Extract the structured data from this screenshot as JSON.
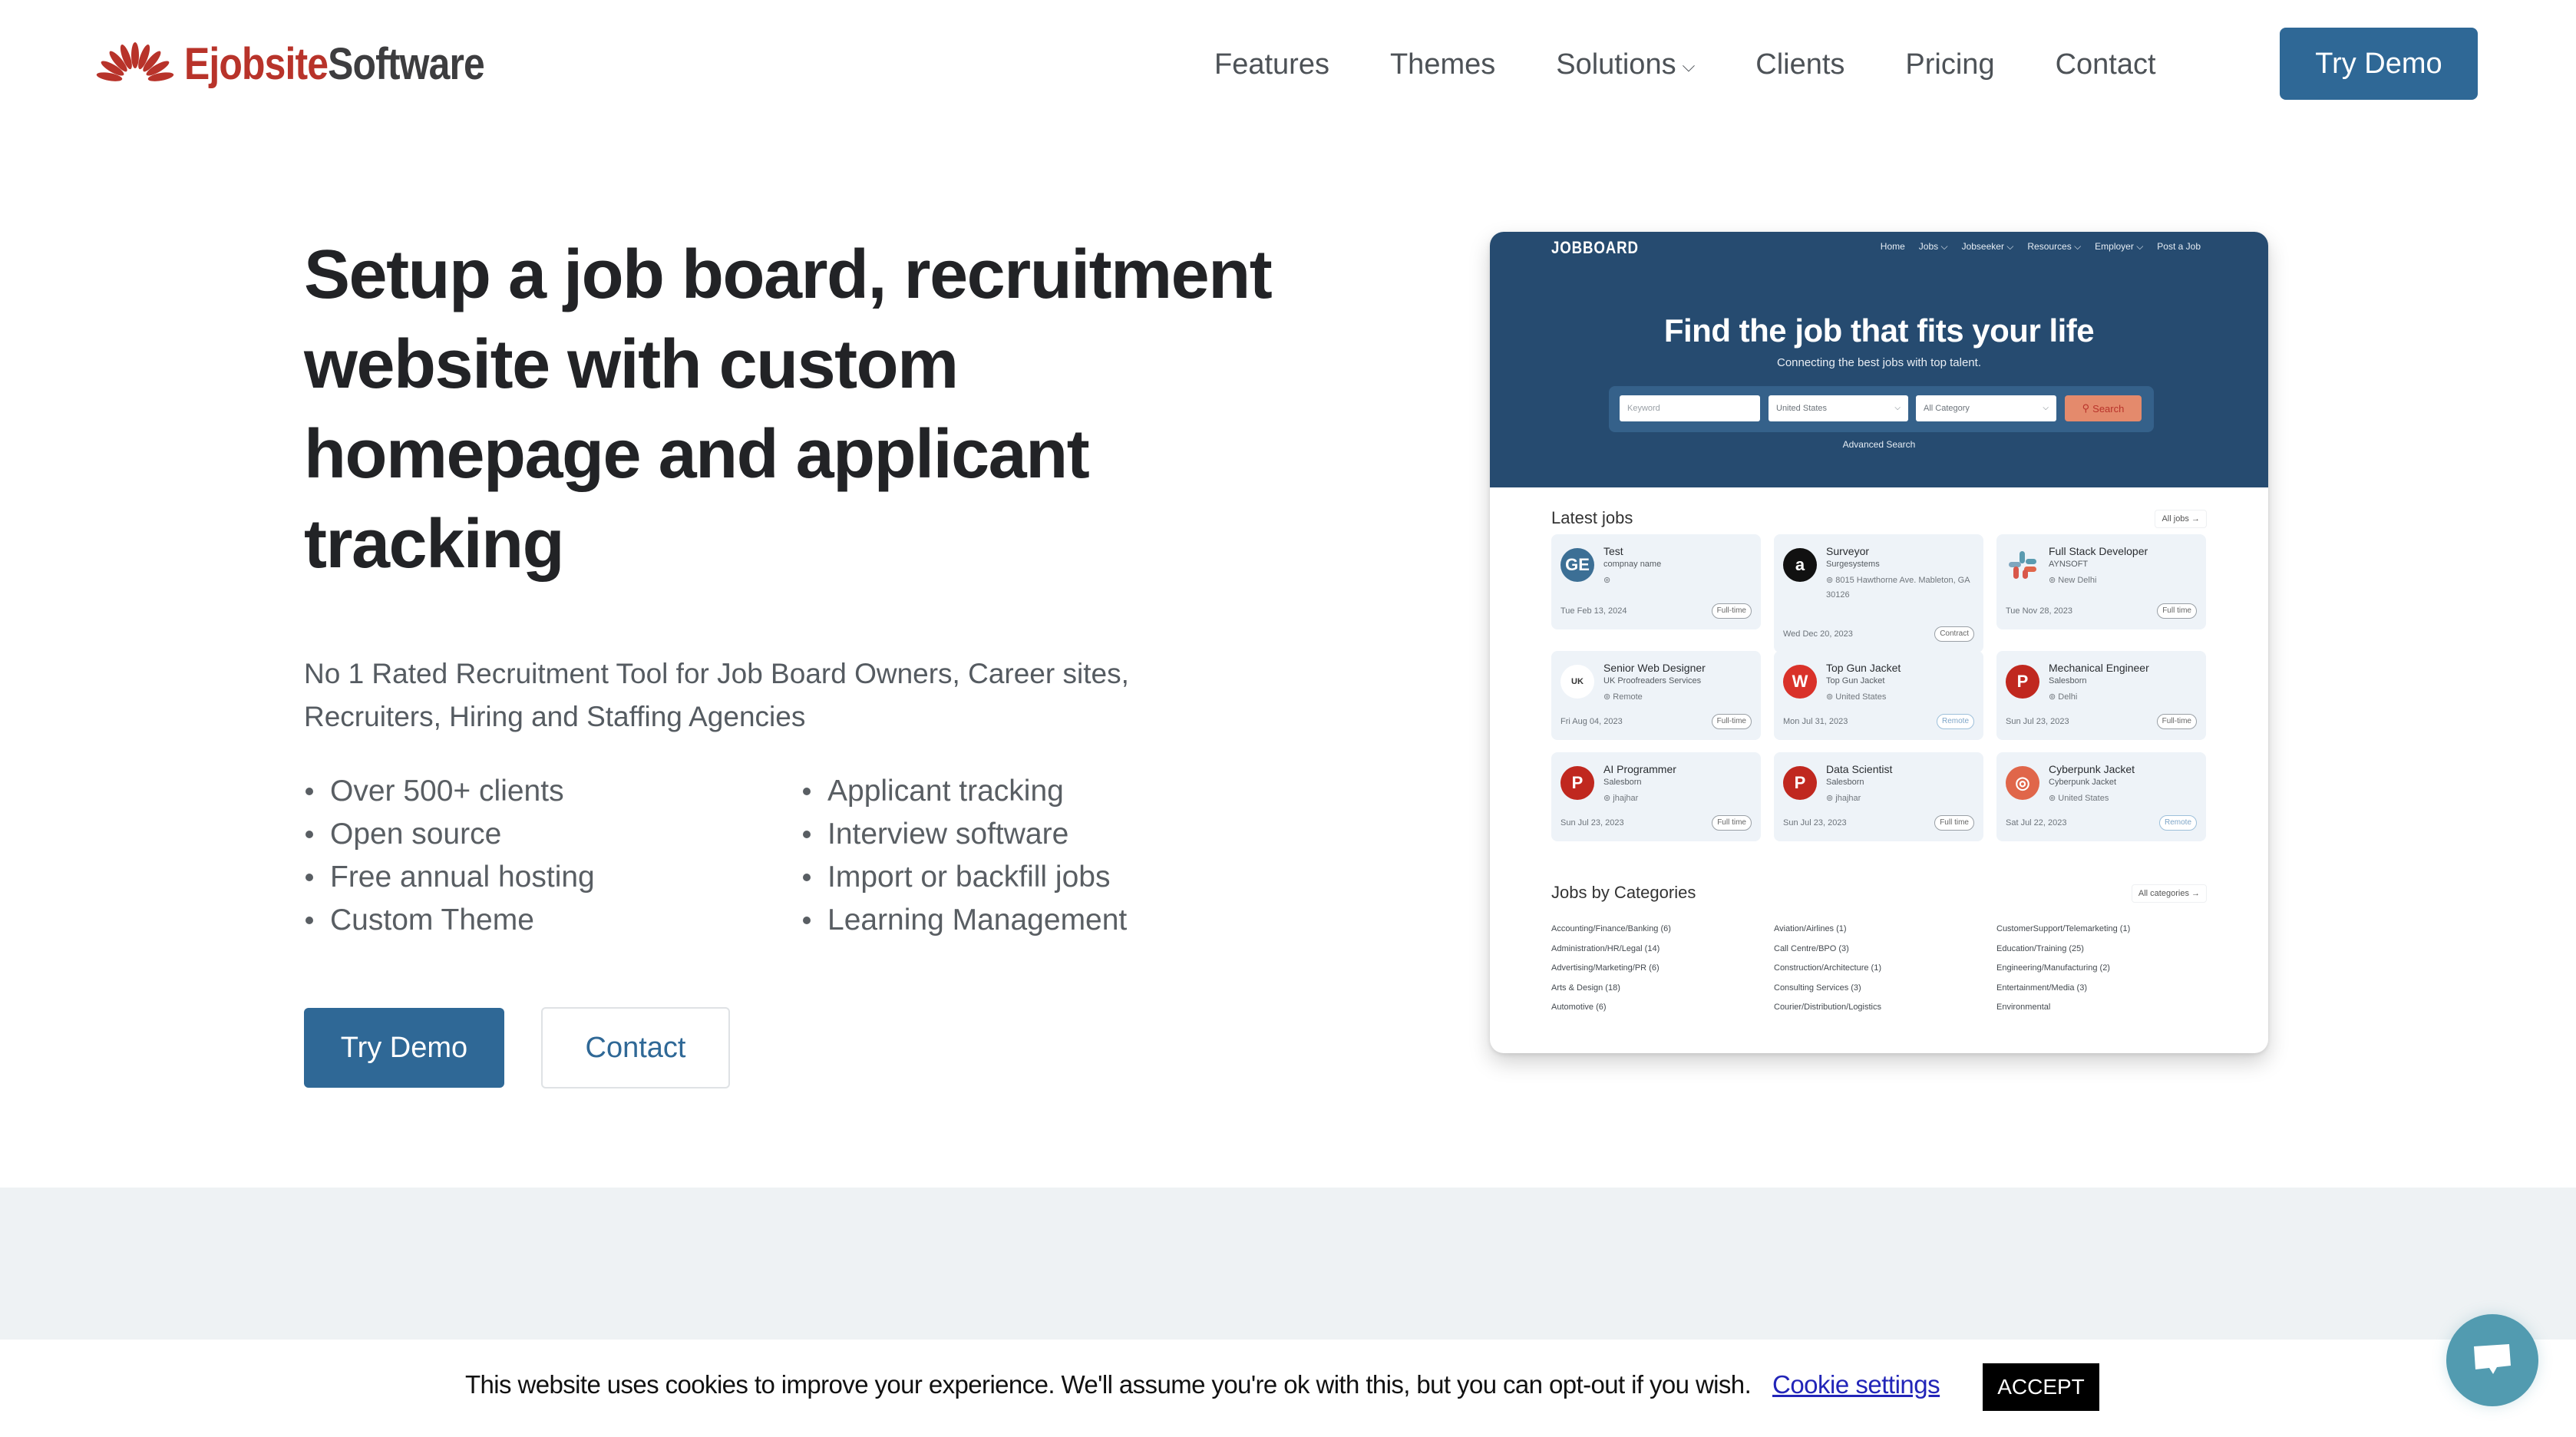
{
  "brand": {
    "name_part1": "Ejobsite",
    "name_part2": "Software",
    "colors": {
      "primary": "#2f6896",
      "logo_red": "#b8332a",
      "logo_gray": "#3d3d3f"
    }
  },
  "nav": {
    "items": [
      {
        "label": "Features",
        "has_dropdown": false
      },
      {
        "label": "Themes",
        "has_dropdown": false
      },
      {
        "label": "Solutions",
        "has_dropdown": true
      },
      {
        "label": "Clients",
        "has_dropdown": false
      },
      {
        "label": "Pricing",
        "has_dropdown": false
      },
      {
        "label": "Contact",
        "has_dropdown": false
      }
    ],
    "cta_label": "Try Demo"
  },
  "hero": {
    "headline": "Setup a job board, recruitment website with custom homepage and applicant tracking",
    "subtitle": "No 1 Rated Recruitment Tool for Job Board Owners, Career sites, Recruiters, Hiring and Staffing Agencies",
    "bullets_left": [
      "Over 500+ clients",
      "Open source",
      "Free annual hosting",
      "Custom Theme"
    ],
    "bullets_right": [
      "Applicant tracking",
      "Interview software",
      "Import or backfill jobs",
      "Learning Management"
    ],
    "primary_button": "Try Demo",
    "secondary_button": "Contact"
  },
  "mockup": {
    "brand": "JOBBOARD",
    "nav": [
      "Home",
      "Jobs ⌵",
      "Jobseeker ⌵",
      "Resources ⌵",
      "Employer ⌵",
      "Post a Job"
    ],
    "title": "Find the job that fits your life",
    "subtitle": "Connecting the best jobs with top talent.",
    "search": {
      "keyword_placeholder": "Keyword",
      "location_value": "United States",
      "category_value": "All Category",
      "button_label": "Search",
      "advanced_label": "Advanced Search"
    },
    "latest_jobs_title": "Latest jobs",
    "all_jobs_label": "All jobs →",
    "jobs": [
      {
        "title": "Test",
        "company": "compnay name",
        "location": "",
        "date": "Tue Feb 13, 2024",
        "type": "Full-time",
        "logo": "ge-logo",
        "logo_color": "#3c6f95",
        "logo_text": "GE"
      },
      {
        "title": "Surveyor",
        "company": "Surgesystems",
        "location": "8015 Hawthorne Ave. Mableton, GA 30126",
        "date": "Wed Dec 20, 2023",
        "type": "Contract",
        "logo": "amazon-logo",
        "logo_color": "#111111",
        "logo_text": "a"
      },
      {
        "title": "Full Stack Developer",
        "company": "AYNSOFT",
        "location": "New Delhi",
        "date": "Tue Nov 28, 2023",
        "type": "Full time",
        "logo": "slack-logo",
        "logo_color": "#eef3f8",
        "logo_text": ""
      },
      {
        "title": "Senior Web Designer",
        "company": "UK Proofreaders Services",
        "location": "Remote",
        "date": "Fri Aug 04, 2023",
        "type": "Full-time",
        "logo": "ukp-logo",
        "logo_color": "#ffffff",
        "logo_text": "UK"
      },
      {
        "title": "Top Gun Jacket",
        "company": "Top Gun Jacket",
        "location": "United States",
        "date": "Mon Jul 31, 2023",
        "type": "Remote",
        "logo": "walgreens-logo",
        "logo_color": "#d9322a",
        "logo_text": "W"
      },
      {
        "title": "Mechanical Engineer",
        "company": "Salesborn",
        "location": "Delhi",
        "date": "Sun Jul 23, 2023",
        "type": "Full-time",
        "logo": "pinterest-logo",
        "logo_color": "#c0281f",
        "logo_text": "P"
      },
      {
        "title": "AI Programmer",
        "company": "Salesborn",
        "location": "jhajhar",
        "date": "Sun Jul 23, 2023",
        "type": "Full time",
        "logo": "pinterest-logo",
        "logo_color": "#c0281f",
        "logo_text": "P"
      },
      {
        "title": "Data Scientist",
        "company": "Salesborn",
        "location": "jhajhar",
        "date": "Sun Jul 23, 2023",
        "type": "Full time",
        "logo": "pinterest-logo",
        "logo_color": "#c0281f",
        "logo_text": "P"
      },
      {
        "title": "Cyberpunk Jacket",
        "company": "Cyberpunk Jacket",
        "location": "United States",
        "date": "Sat Jul 22, 2023",
        "type": "Remote",
        "logo": "instagram-logo",
        "logo_color": "#e0664a",
        "logo_text": "◎"
      }
    ],
    "categories_title": "Jobs by Categories",
    "all_categories_label": "All categories →",
    "categories": [
      [
        "Accounting/Finance/Banking (6)",
        "Administration/HR/Legal (14)",
        "Advertising/Marketing/PR (6)",
        "Arts & Design (18)",
        "Automotive (6)"
      ],
      [
        "Aviation/Airlines (1)",
        "Call Centre/BPO (3)",
        "Construction/Architecture (1)",
        "Consulting Services (3)",
        "Courier/Distribution/Logistics"
      ],
      [
        "CustomerSupport/Telemarketing (1)",
        "Education/Training (25)",
        "Engineering/Manufacturing (2)",
        "Entertainment/Media (3)",
        "Environmental"
      ]
    ]
  },
  "cookie": {
    "message": "This website uses cookies to improve your experience. We'll assume you're ok with this, but you can opt-out if you wish.",
    "settings_link": "Cookie settings",
    "accept_label": "ACCEPT"
  },
  "chat": {
    "icon": "chat-bubble-icon",
    "color": "#529bb0"
  }
}
